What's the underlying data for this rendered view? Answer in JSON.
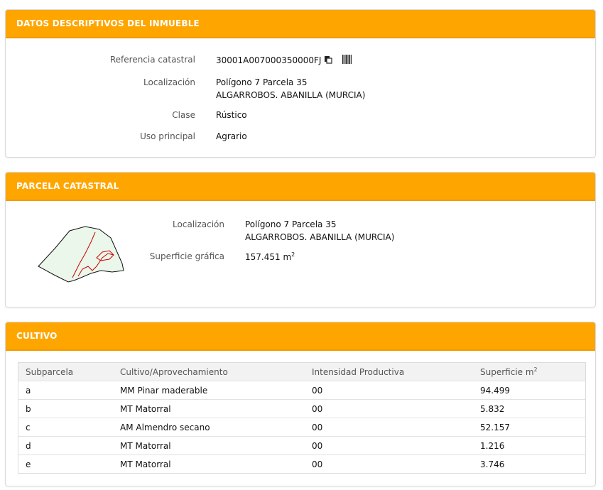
{
  "descriptivos": {
    "title": "DATOS DESCRIPTIVOS DEL INMUEBLE",
    "ref_label": "Referencia catastral",
    "ref_value": "30001A007000350000FJ",
    "loc_label": "Localización",
    "loc_line1": "Polígono 7 Parcela 35",
    "loc_line2": "ALGARROBOS. ABANILLA (MURCIA)",
    "clase_label": "Clase",
    "clase_value": "Rústico",
    "uso_label": "Uso principal",
    "uso_value": "Agrario"
  },
  "parcela": {
    "title": "PARCELA CATASTRAL",
    "loc_label": "Localización",
    "loc_line1": "Polígono 7 Parcela 35",
    "loc_line2": "ALGARROBOS. ABANILLA (MURCIA)",
    "sup_label": "Superficie gráfica",
    "sup_value": "157.451 m",
    "sup_exp": "2"
  },
  "cultivo": {
    "title": "CULTIVO",
    "headers": [
      "Subparcela",
      "Cultivo/Aprovechamiento",
      "Intensidad Productiva",
      "Superficie m"
    ],
    "header_exp": "2",
    "rows": [
      [
        "a",
        "MM Pinar maderable",
        "00",
        "94.499"
      ],
      [
        "b",
        "MT Matorral",
        "00",
        "5.832"
      ],
      [
        "c",
        "AM Almendro secano",
        "00",
        "52.157"
      ],
      [
        "d",
        "MT Matorral",
        "00",
        "1.216"
      ],
      [
        "e",
        "MT Matorral",
        "00",
        "3.746"
      ]
    ]
  },
  "colors": {
    "header": "#ffa500",
    "parcel_fill": "#eaf7ea",
    "subparcel_line": "#cc0000"
  },
  "icons": [
    "copy-icon",
    "barcode-icon"
  ]
}
